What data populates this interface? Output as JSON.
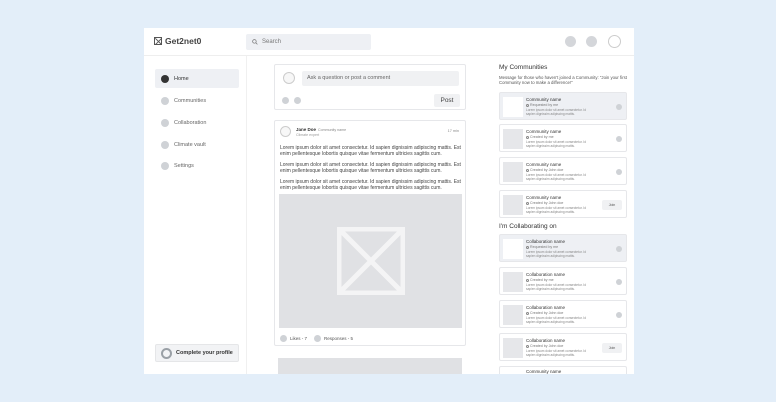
{
  "app": {
    "logo": "Get2net0"
  },
  "search": {
    "placeholder": "Search"
  },
  "sidebar": {
    "items": [
      {
        "label": "Home",
        "active": true
      },
      {
        "label": "Communities"
      },
      {
        "label": "Collaboration"
      },
      {
        "label": "Climate vault"
      },
      {
        "label": "Settings"
      }
    ],
    "complete_profile": "Complete your profile"
  },
  "composer": {
    "placeholder": "Ask a question or post a comment",
    "post_label": "Post"
  },
  "post": {
    "author": "Jane Doe",
    "community": "Community name",
    "subtitle": "Climate expert",
    "time": "17 min",
    "paragraphs": [
      "Lorem ipsum dolor sit amet consectetur. Id sapien dignissim adipiscing mattis. Est enim pellentesque lobortis quisque vitae fermentum ultricies sagittis cum.",
      "Lorem ipsum dolor sit amet consectetur. Id sapien dignissim adipiscing mattis. Est enim pellentesque lobortis quisque vitae fermentum ultricies sagittis cum.",
      "Lorem ipsum dolor sit amet consectetur. Id sapien dignissim adipiscing mattis. Est enim pellentesque lobortis quisque vitae fermentum ultricies sagittis cum."
    ],
    "likes": "Likes - 7",
    "responses": "Responses - 5"
  },
  "communities": {
    "title": "My Communities",
    "description": "Message for those who haven't joined a Community: \"Join your first Community now to make a difference!\"",
    "items": [
      {
        "name": "Community name",
        "sub": "Requested by me",
        "desc": "Lorem ipsum dolor sit amet consectetur. Id sapien dignissim adipiscing mattis.",
        "highlight": true
      },
      {
        "name": "Community name",
        "sub": "Created by me",
        "desc": "Lorem ipsum dolor sit amet consectetur. Id sapien dignissim adipiscing mattis."
      },
      {
        "name": "Community name",
        "sub": "Created by John doe",
        "desc": "Lorem ipsum dolor sit amet consectetur. Id sapien dignissim adipiscing mattis."
      },
      {
        "name": "Community name",
        "sub": "Created by John doe",
        "desc": "Lorem ipsum dolor sit amet consectetur. Id sapien dignissim adipiscing mattis.",
        "join": "Join"
      }
    ]
  },
  "collaborations": {
    "title": "I'm Collaborating on",
    "items": [
      {
        "name": "Collaboration name",
        "sub": "Requested by me",
        "desc": "Lorem ipsum dolor sit amet consectetur. Id sapien dignissim adipiscing mattis.",
        "highlight": true
      },
      {
        "name": "Collaboration name",
        "sub": "Created by me",
        "desc": "Lorem ipsum dolor sit amet consectetur. Id sapien dignissim adipiscing mattis."
      },
      {
        "name": "Collaboration name",
        "sub": "Created by John doe",
        "desc": "Lorem ipsum dolor sit amet consectetur. Id sapien dignissim adipiscing mattis."
      },
      {
        "name": "Collaboration name",
        "sub": "Created by John doe",
        "desc": "Lorem ipsum dolor sit amet consectetur. Id sapien dignissim adipiscing mattis.",
        "join": "Join"
      },
      {
        "name": "Community name"
      }
    ]
  }
}
